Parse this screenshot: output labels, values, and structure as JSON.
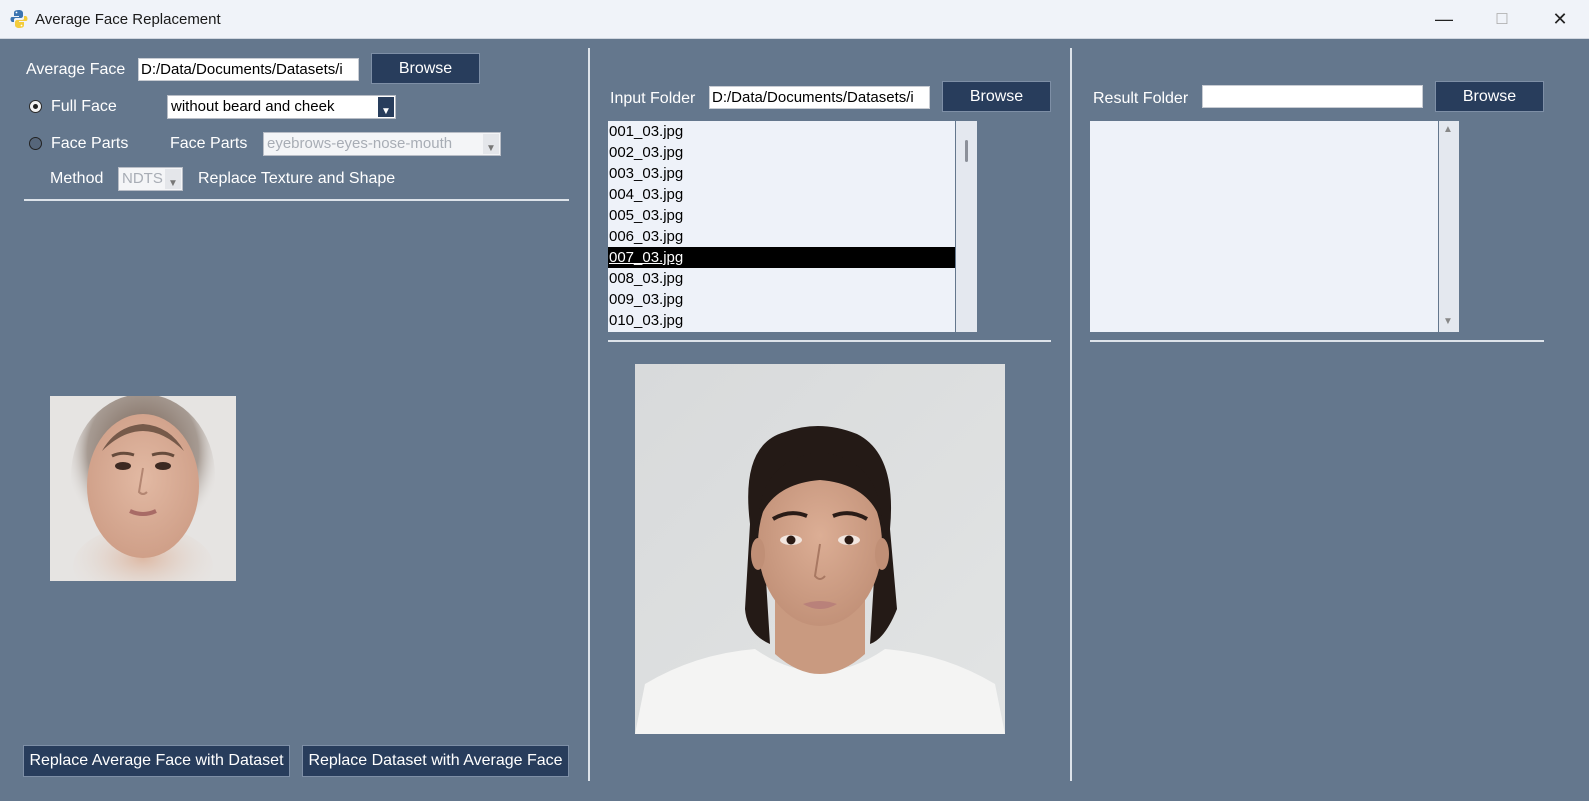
{
  "window": {
    "title": "Average Face Replacement",
    "minimize_glyph": "—",
    "maximize_glyph": "☐",
    "close_glyph": "✕"
  },
  "left_panel": {
    "average_face_label": "Average Face",
    "average_face_path": "D:/Data/Documents/Datasets/i",
    "browse_label": "Browse",
    "full_face_label": "Full Face",
    "full_face_selected": true,
    "full_face_option": "without beard and cheek",
    "face_parts_radio_label": "Face Parts",
    "face_parts_label": "Face Parts",
    "face_parts_option": "eyebrows-eyes-nose-mouth",
    "method_label": "Method",
    "method_option": "NDTS",
    "replace_mode_label": "Replace Texture and Shape",
    "btn_replace_avg_with_dataset": "Replace Average Face with Dataset",
    "btn_replace_dataset_with_avg": "Replace Dataset with Average Face"
  },
  "middle_panel": {
    "input_folder_label": "Input Folder",
    "input_folder_path": "D:/Data/Documents/Datasets/i",
    "browse_label": "Browse",
    "files": [
      "001_03.jpg",
      "002_03.jpg",
      "003_03.jpg",
      "004_03.jpg",
      "005_03.jpg",
      "006_03.jpg",
      "007_03.jpg",
      "008_03.jpg",
      "009_03.jpg",
      "010_03.jpg"
    ],
    "selected_file": "007_03.jpg"
  },
  "right_panel": {
    "result_folder_label": "Result Folder",
    "result_folder_path": "",
    "browse_label": "Browse",
    "scroll_up_glyph": "▲",
    "scroll_down_glyph": "▼"
  },
  "colors": {
    "background": "#64778d",
    "button": "#283d5c",
    "selection": "#000000"
  }
}
